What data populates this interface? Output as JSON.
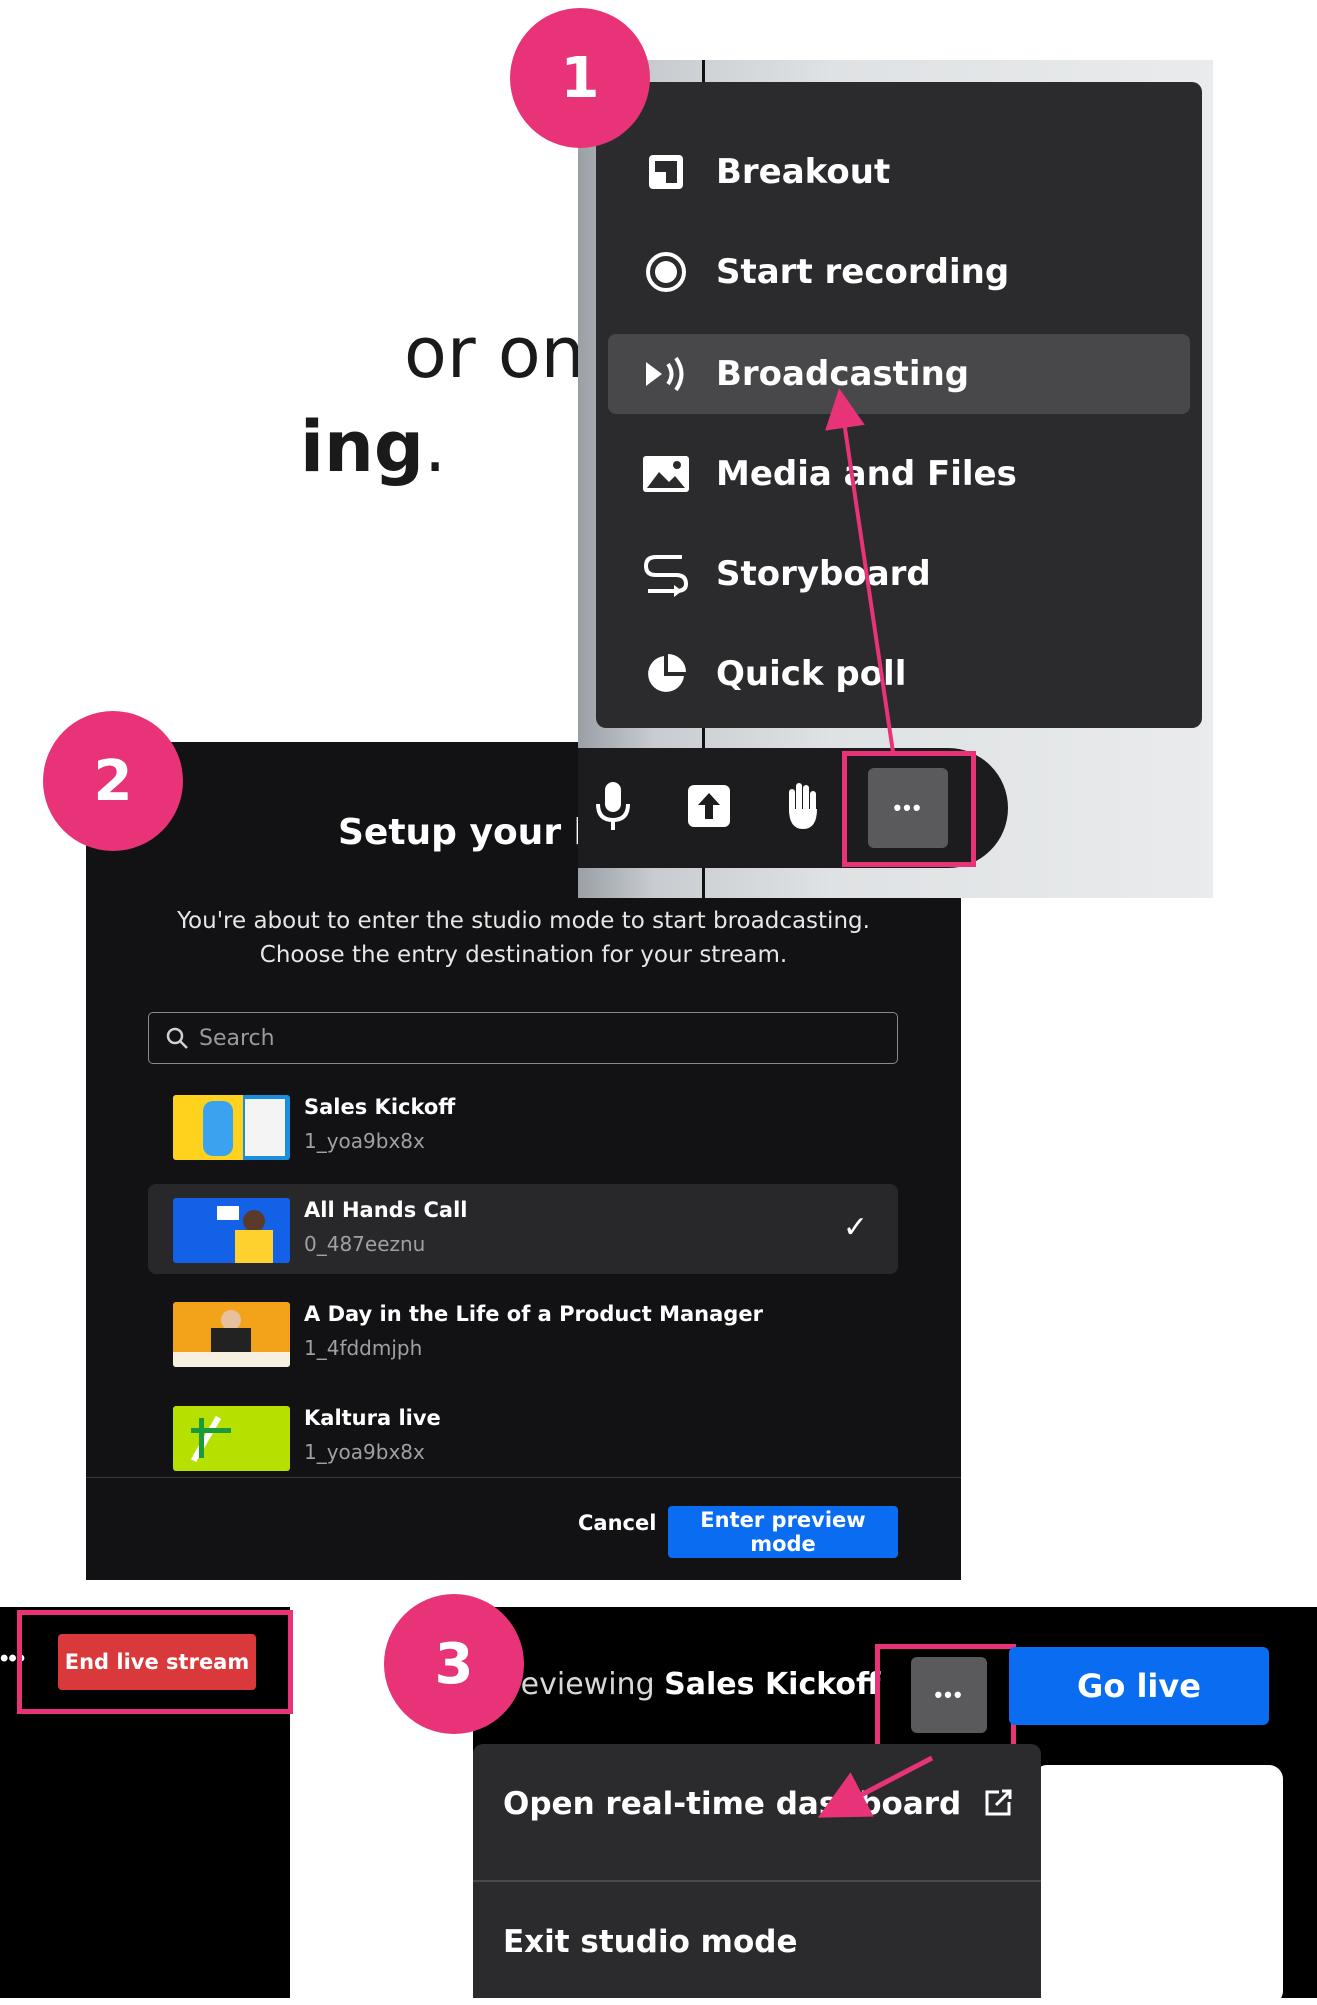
{
  "slide": {
    "line1": "or on-demand",
    "line2_bold": "ing",
    "line2_end": "."
  },
  "badges": [
    "1",
    "2",
    "3"
  ],
  "colors": {
    "badge": "#e83378",
    "highlight_box": "#e83378",
    "primary_blue": "#0a6cf0",
    "end_red": "#d9393b",
    "menu_bg": "#2b2b2d"
  },
  "meeting_menu": {
    "items": [
      {
        "label": "Breakout",
        "icon": "breakout-icon"
      },
      {
        "label": "Start recording",
        "icon": "record-icon"
      },
      {
        "label": "Broadcasting",
        "icon": "broadcast-icon"
      },
      {
        "label": "Media and Files",
        "icon": "image-icon"
      },
      {
        "label": "Storyboard",
        "icon": "storyboard-icon"
      },
      {
        "label": "Quick poll",
        "icon": "pie-chart-icon"
      }
    ],
    "highlighted": "Broadcasting"
  },
  "toolbar": {
    "buttons": [
      "microphone-icon",
      "share-upload-icon",
      "raise-hand-icon",
      "more-icon"
    ],
    "more_label": "•••"
  },
  "setup_dialog": {
    "title": "Setup your br",
    "description_line1": "You're about to enter the studio mode to start broadcasting.",
    "description_line2": "Choose the entry destination for your stream.",
    "search_placeholder": "Search",
    "entries": [
      {
        "name": "Sales Kickoff",
        "id": "1_yoa9bx8x",
        "selected": false
      },
      {
        "name": "All Hands Call",
        "id": "0_487eeznu",
        "selected": true
      },
      {
        "name": "A Day in the Life of a Product Manager",
        "id": "1_4fddmjph",
        "selected": false
      },
      {
        "name": "Kaltura live",
        "id": "1_yoa9bx8x",
        "selected": false
      }
    ],
    "check": "✓",
    "cancel_label": "Cancel",
    "enter_label": "Enter preview mode"
  },
  "live_bar": {
    "dots": "•••",
    "end_label": "End live stream"
  },
  "studio": {
    "previewing_prefix": "reviewing",
    "previewing_name": "Sales Kickoff",
    "more_label": "•••",
    "go_live_label": "Go live",
    "menu_items": [
      {
        "label": "Open real-time dashboard",
        "icon": "external-link-icon"
      },
      {
        "label": "Exit studio mode"
      }
    ]
  }
}
